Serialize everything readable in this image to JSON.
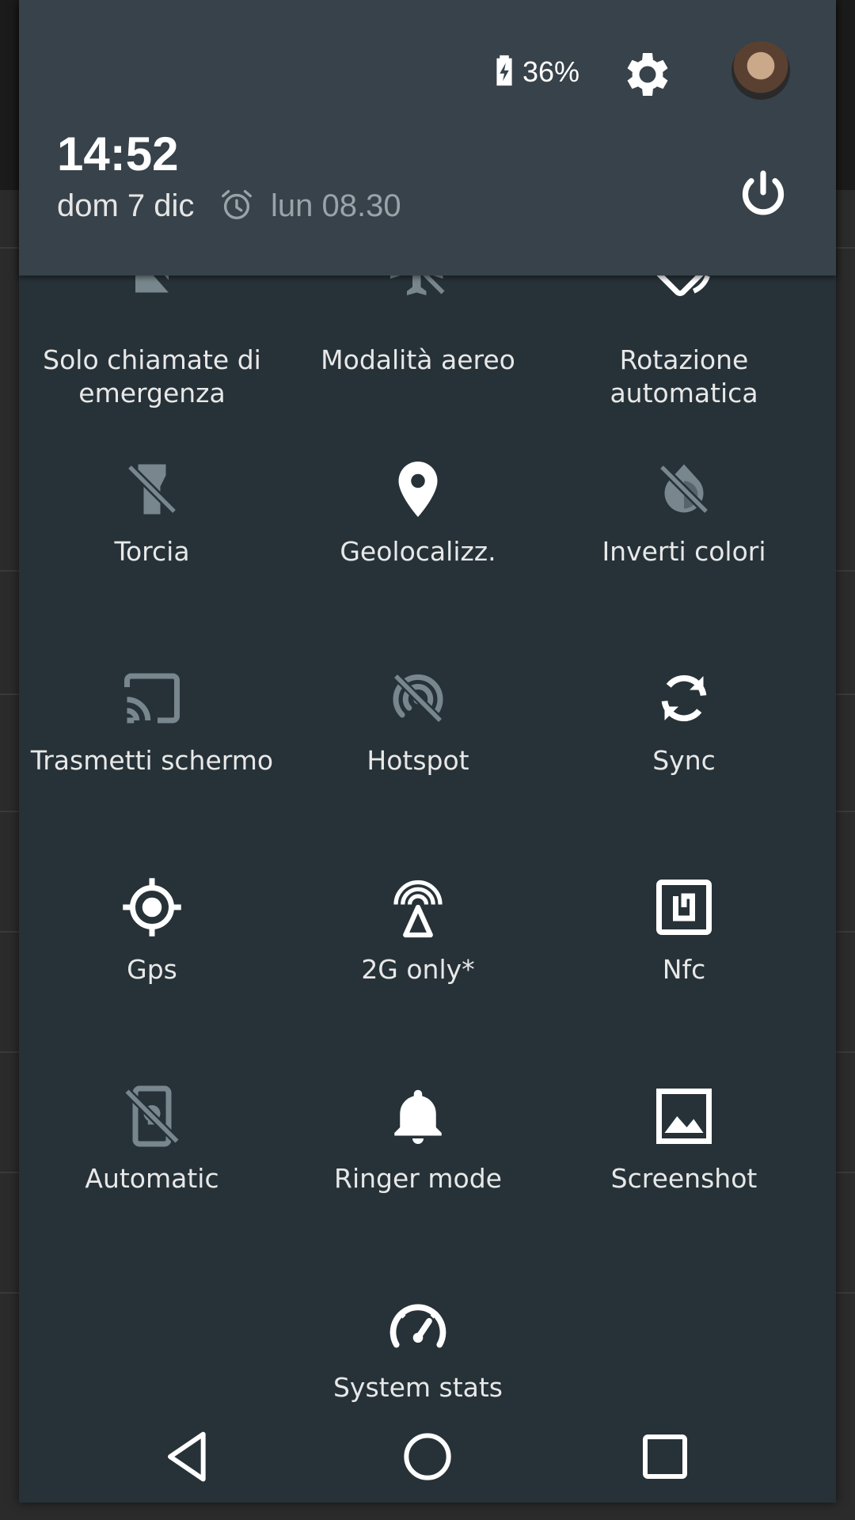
{
  "status": {
    "battery_percent": "36%",
    "time": "14:52",
    "date": "dom 7 dic",
    "alarm": "lun 08.30"
  },
  "tiles": [
    {
      "label": "Solo chiamate di emergenza",
      "icon": "sim-card-icon",
      "active": false
    },
    {
      "label": "Modalità aereo",
      "icon": "airplane-icon",
      "active": false
    },
    {
      "label": "Rotazione automatica",
      "icon": "screen-rotation-icon",
      "active": true
    },
    {
      "label": "Torcia",
      "icon": "flashlight-off-icon",
      "active": false
    },
    {
      "label": "Geolocalizz.",
      "icon": "location-pin-icon",
      "active": true
    },
    {
      "label": "Inverti colori",
      "icon": "invert-colors-off-icon",
      "active": false
    },
    {
      "label": "Trasmetti schermo",
      "icon": "cast-icon",
      "active": false
    },
    {
      "label": "Hotspot",
      "icon": "hotspot-off-icon",
      "active": false
    },
    {
      "label": "Sync",
      "icon": "sync-icon",
      "active": true
    },
    {
      "label": "Gps",
      "icon": "gps-fixed-icon",
      "active": true
    },
    {
      "label": "2G only*",
      "icon": "antenna-icon",
      "active": true
    },
    {
      "label": "Nfc",
      "icon": "nfc-icon",
      "active": true
    },
    {
      "label": "Automatic",
      "icon": "brightness-off-icon",
      "active": false
    },
    {
      "label": "Ringer mode",
      "icon": "bell-icon",
      "active": true
    },
    {
      "label": "Screenshot",
      "icon": "image-icon",
      "active": true
    },
    {
      "label": "System stats",
      "icon": "speedometer-icon",
      "active": true
    }
  ],
  "colors": {
    "panel": "#263238",
    "header": "#37424a",
    "active_icon": "#ffffff",
    "inactive_icon": "#78868d"
  }
}
